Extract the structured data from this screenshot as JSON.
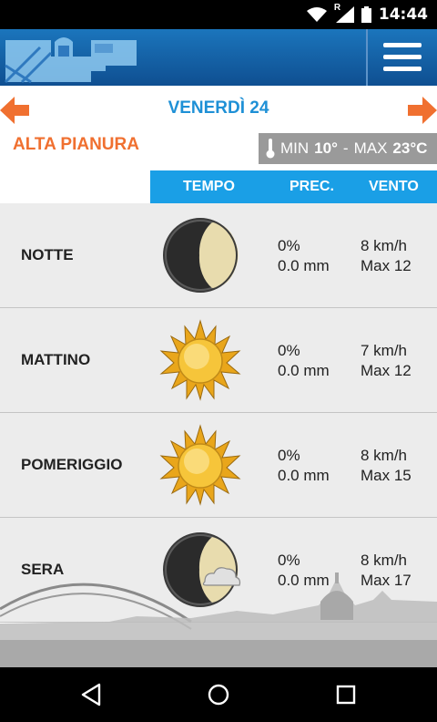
{
  "status_bar": {
    "time": "14:44",
    "roaming": "R",
    "icons": [
      "wifi-icon",
      "signal-icon",
      "battery-icon"
    ]
  },
  "header": {
    "logo": "city-skyline-logo",
    "menu_icon": "hamburger-menu-icon"
  },
  "day_nav": {
    "prev_icon": "arrow-left-icon",
    "next_icon": "arrow-right-icon",
    "day": "VENERDÌ 24"
  },
  "zone": "ALTA PIANURA",
  "temps": {
    "min_label": "MIN",
    "min_value": "10°",
    "separator": "-",
    "max_label": "MAX",
    "max_value": "23°C",
    "icon": "thermometer-icon"
  },
  "columns": {
    "tempo": "TEMPO",
    "prec": "PREC.",
    "vento": "VENTO"
  },
  "rows": [
    {
      "period": "NOTTE",
      "icon": "moon-icon",
      "prec_pct": "0%",
      "prec_mm": "0.0 mm",
      "wind": "8 km/h",
      "wind_max": "Max 12"
    },
    {
      "period": "MATTINO",
      "icon": "sun-icon",
      "prec_pct": "0%",
      "prec_mm": "0.0 mm",
      "wind": "7 km/h",
      "wind_max": "Max 12"
    },
    {
      "period": "POMERIGGIO",
      "icon": "sun-icon",
      "prec_pct": "0%",
      "prec_mm": "0.0 mm",
      "wind": "8 km/h",
      "wind_max": "Max 15"
    },
    {
      "period": "SERA",
      "icon": "moon-cloud-icon",
      "prec_pct": "0%",
      "prec_mm": "0.0 mm",
      "wind": "8 km/h",
      "wind_max": "Max 17"
    }
  ],
  "colors": {
    "accent_blue": "#1a9fe6",
    "accent_orange": "#f07030",
    "header_blue": "#1b75bc",
    "row_bg": "#ececec"
  },
  "nav_bar": {
    "back_icon": "back-icon",
    "home_icon": "home-icon",
    "recents_icon": "recents-icon"
  }
}
